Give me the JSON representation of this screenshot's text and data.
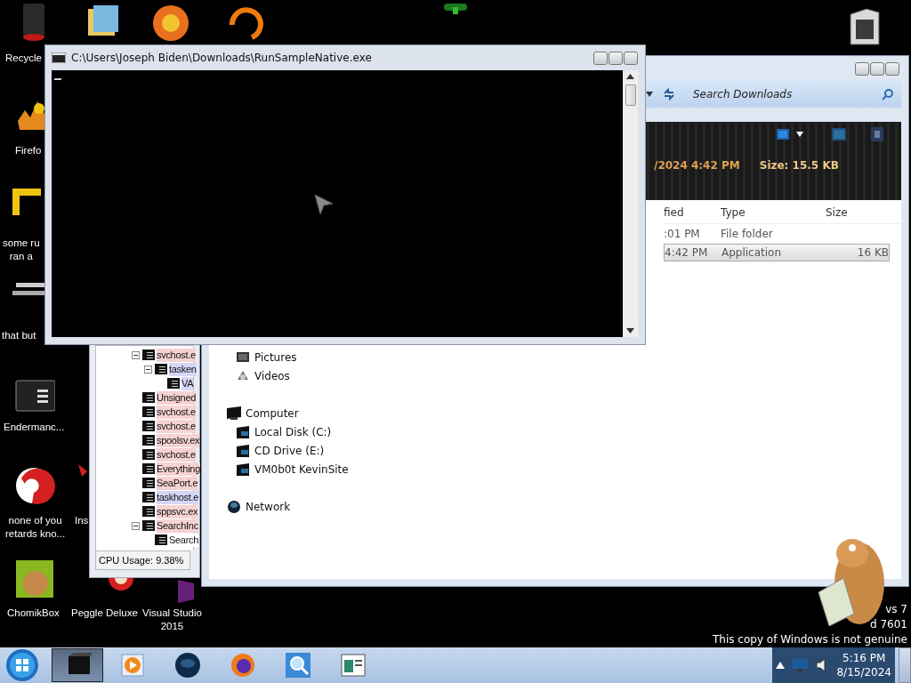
{
  "desktop_icons": [
    {
      "lines": [
        "Recycle"
      ]
    },
    {
      "lines": [
        "Firefo"
      ]
    },
    {
      "lines": [
        "some ru",
        "ran a"
      ]
    },
    {
      "lines": [
        "that but"
      ]
    },
    {
      "lines": [
        "Endermanc..."
      ]
    },
    {
      "lines": [
        "none of you",
        "retards kno..."
      ]
    },
    {
      "lines": [
        "Ins"
      ]
    },
    {
      "lines": [
        "ChomikBox"
      ]
    },
    {
      "lines": [
        "Peggle Deluxe"
      ]
    },
    {
      "lines": [
        "Visual Studio",
        "2015"
      ]
    }
  ],
  "process_window": {
    "tree": [
      {
        "label": "svchost.e",
        "color": "#f6d2d2",
        "expanded": true,
        "children": [
          {
            "label": "tasken",
            "color": "#d6d6f6",
            "expanded": true,
            "children": [
              {
                "label": "VA",
                "color": "#d6d6f6"
              }
            ]
          }
        ]
      },
      {
        "label": "Unsigned",
        "color": "#f6d2d2"
      },
      {
        "label": "svchost.e",
        "color": "#f6d2d2"
      },
      {
        "label": "svchost.e",
        "color": "#f6d2d2"
      },
      {
        "label": "spoolsv.ex",
        "color": "#f6d2d2"
      },
      {
        "label": "svchost.e",
        "color": "#f6d2d2"
      },
      {
        "label": "Everything",
        "color": "#f6d2d2"
      },
      {
        "label": "SeaPort.e",
        "color": "#f6d2d2"
      },
      {
        "label": "taskhost.e",
        "color": "#d6d6f6"
      },
      {
        "label": "sppsvc.ex",
        "color": "#f6d2d2"
      },
      {
        "label": "SearchInc",
        "color": "#f6d2d2",
        "expanded": true,
        "children": [
          {
            "label": "Search",
            "color": "#ffffff"
          }
        ]
      }
    ],
    "status": "CPU Usage: 9.38%"
  },
  "explorer_window": {
    "search": {
      "placeholder": "Search Downloads"
    },
    "details": {
      "modified": "/2024 4:42 PM",
      "size": "Size: 15.5 KB"
    },
    "columns": [
      "fied",
      "Type",
      "Size"
    ],
    "rows": [
      {
        "cells": [
          ":01 PM",
          "File folder",
          ""
        ],
        "selected": false
      },
      {
        "cells": [
          "4:42 PM",
          "Application",
          "16 KB"
        ],
        "selected": true
      }
    ],
    "nav": [
      {
        "children": [
          {
            "label": "Pictures"
          },
          {
            "label": "Videos"
          }
        ]
      },
      {
        "label": "Computer",
        "children": [
          {
            "label": "Local Disk (C:)"
          },
          {
            "label": "CD Drive (E:)"
          },
          {
            "label": "VM0b0t KevinSite"
          }
        ]
      },
      {
        "label": "Network"
      }
    ]
  },
  "console_window": {
    "title": "C:\\Users\\Joseph Biden\\Downloads\\RunSampleNative.exe"
  },
  "watermark": [
    "vs 7",
    "d 7601",
    "This copy of Windows is not genuine"
  ],
  "taskbar": {
    "buttons": [
      {
        "active": true
      },
      {
        "active": false
      },
      {
        "active": false
      },
      {
        "active": false
      },
      {
        "active": false
      },
      {
        "active": false
      }
    ],
    "time": "5:16 PM",
    "date": "8/15/2024"
  }
}
